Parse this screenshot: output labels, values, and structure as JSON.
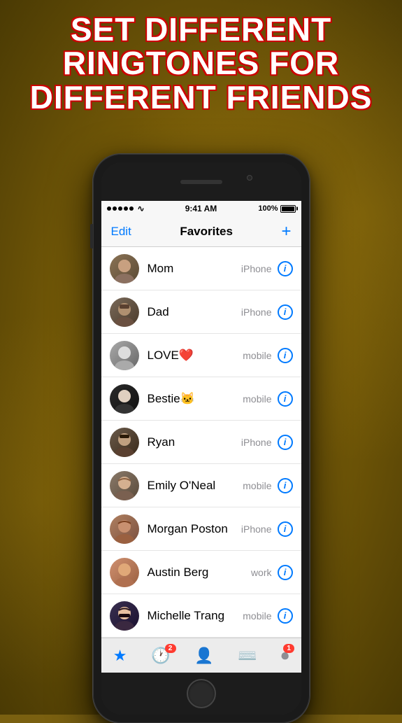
{
  "background": {
    "color": "#7a6010"
  },
  "headline": {
    "line1": "SET DIFFERENT",
    "line2": "RINGTONES FOR",
    "line3": "DIFFERENT FRIENDS",
    "full": "SET DIFFERENT\nRINGTONES FOR\nDIFFERENT FRIENDS"
  },
  "status_bar": {
    "signal_dots": 5,
    "wifi": "wifi",
    "time": "9:41 AM",
    "battery": "100%"
  },
  "nav": {
    "edit_label": "Edit",
    "title": "Favorites",
    "add_label": "+"
  },
  "contacts": [
    {
      "id": 1,
      "name": "Mom",
      "type": "iPhone",
      "avatar_class": "avatar-1",
      "emoji": "👩"
    },
    {
      "id": 2,
      "name": "Dad",
      "type": "iPhone",
      "avatar_class": "avatar-2",
      "emoji": "👨"
    },
    {
      "id": 3,
      "name": "LOVE❤️",
      "type": "mobile",
      "avatar_class": "avatar-3",
      "emoji": "👱"
    },
    {
      "id": 4,
      "name": "Bestie🐱",
      "type": "mobile",
      "avatar_class": "avatar-4",
      "emoji": "👩"
    },
    {
      "id": 5,
      "name": "Ryan",
      "type": "iPhone",
      "avatar_class": "avatar-5",
      "emoji": "👦"
    },
    {
      "id": 6,
      "name": "Emily O'Neal",
      "type": "mobile",
      "avatar_class": "avatar-6",
      "emoji": "👩"
    },
    {
      "id": 7,
      "name": "Morgan Poston",
      "type": "iPhone",
      "avatar_class": "avatar-7",
      "emoji": "👩"
    },
    {
      "id": 8,
      "name": "Austin Berg",
      "type": "work",
      "avatar_class": "avatar-8",
      "emoji": "👦"
    },
    {
      "id": 9,
      "name": "Michelle Trang",
      "type": "mobile",
      "avatar_class": "avatar-9",
      "emoji": "👩"
    }
  ],
  "tab_bar": {
    "items": [
      {
        "icon": "★",
        "label": "Favorites",
        "active": true,
        "badge": null
      },
      {
        "icon": "▲",
        "label": "Recents",
        "active": false,
        "badge": "2"
      },
      {
        "icon": "◎",
        "label": "Contacts",
        "active": false,
        "badge": null
      },
      {
        "icon": "⌨",
        "label": "Keypad",
        "active": false,
        "badge": null
      },
      {
        "icon": "◉",
        "label": "Voicemail",
        "active": false,
        "badge": "1"
      }
    ]
  }
}
